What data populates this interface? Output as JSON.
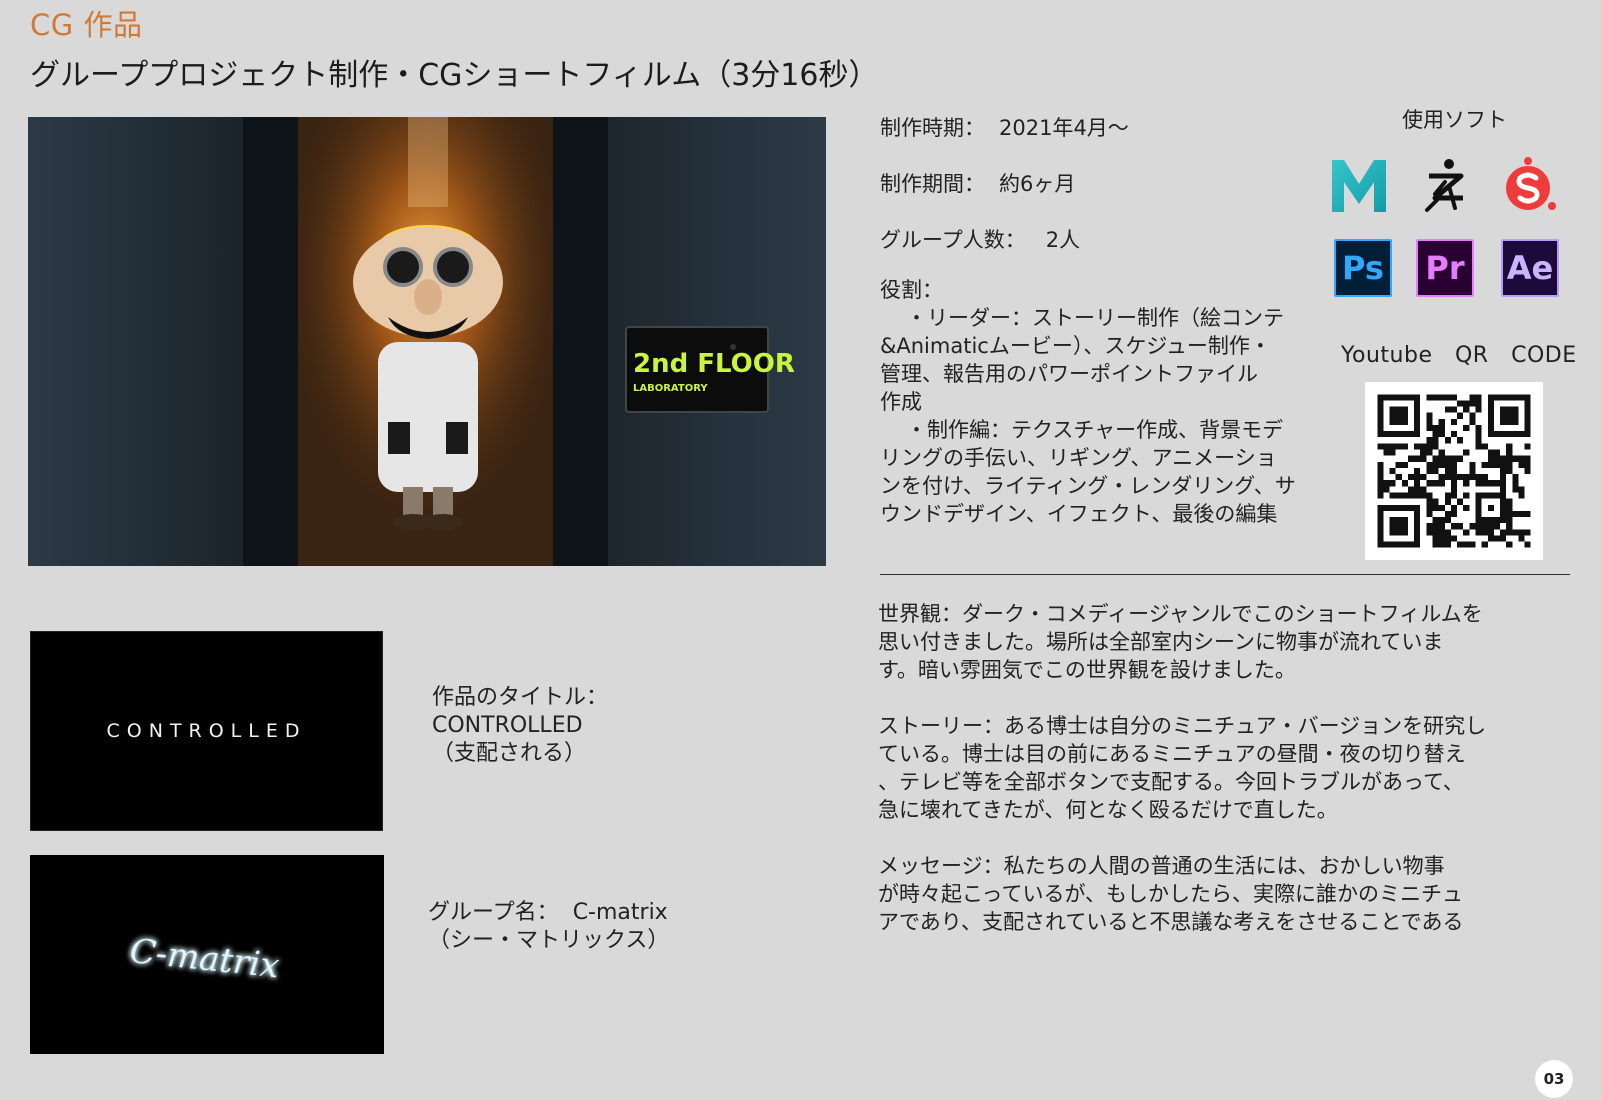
{
  "header": {
    "section_label": "CG 作品",
    "title": "グループプロジェクト制作・CGショートフィルム（3分16秒）"
  },
  "hero": {
    "sign_line1": "2nd FLOOR",
    "sign_line2": "LABORATORY"
  },
  "details": {
    "period_label": "制作時期：",
    "period_value": "2021年4月～",
    "duration_label": "制作期間：",
    "duration_value": "約6ヶ月",
    "members_label": "グループ人数：",
    "members_value": "2人",
    "roles_label": "役割：",
    "roles_lines": [
      "・リーダー：ストーリー制作（絵コンテ",
      "&Animaticムービー）、スケジュー制作・",
      "管理、報告用のパワーポイントファイル",
      "作成",
      "・制作編：テクスチャー作成、背景モデ",
      "リングの手伝い、リギング、アニメーショ",
      "ンを付け、ライティング・レンダリング、サ",
      "ウンドデザイン、イフェクト、最後の編集"
    ]
  },
  "software": {
    "title": "使用ソフト",
    "icons": [
      "maya-icon",
      "zbrush-icon",
      "substance-painter-icon",
      "photoshop-icon",
      "premiere-icon",
      "after-effects-icon"
    ],
    "ps": "Ps",
    "pr": "Pr",
    "ae": "Ae"
  },
  "qr": {
    "label": "Youtube　QR　CODE"
  },
  "description": {
    "world": [
      "世界観：ダーク・コメディージャンルでこのショートフィルムを",
      "思い付きました。場所は全部室内シーンに物事が流れていま",
      "す。暗い雰囲気でこの世界観を設けました。"
    ],
    "story": [
      "ストーリー：ある博士は自分のミニチュア・バージョンを研究し",
      "ている。博士は目の前にあるミニチュアの昼間・夜の切り替え",
      "、テレビ等を全部ボタンで支配する。今回トラブルがあって、",
      "急に壊れてきたが、何となく殴るだけで直した。"
    ],
    "message": [
      "メッセージ：私たちの人間の普通の生活には、おかしい物事",
      "が時々起こっているが、もしかしたら、実際に誰かのミニチュ",
      "アであり、支配されていると不思議な考えをさせることである"
    ]
  },
  "work": {
    "thumb_title": "CONTROLLED",
    "title_label": "作品のタイトル：",
    "title_value": "CONTROLLED",
    "title_sub": "（支配される）",
    "thumb_group": "C-matrix",
    "group_label": "グループ名：",
    "group_value": "C-matrix",
    "group_sub": "（シー・マトリックス）"
  },
  "page_number": "03",
  "colors": {
    "accent": "#d27a34",
    "background": "#d9d9d9"
  }
}
